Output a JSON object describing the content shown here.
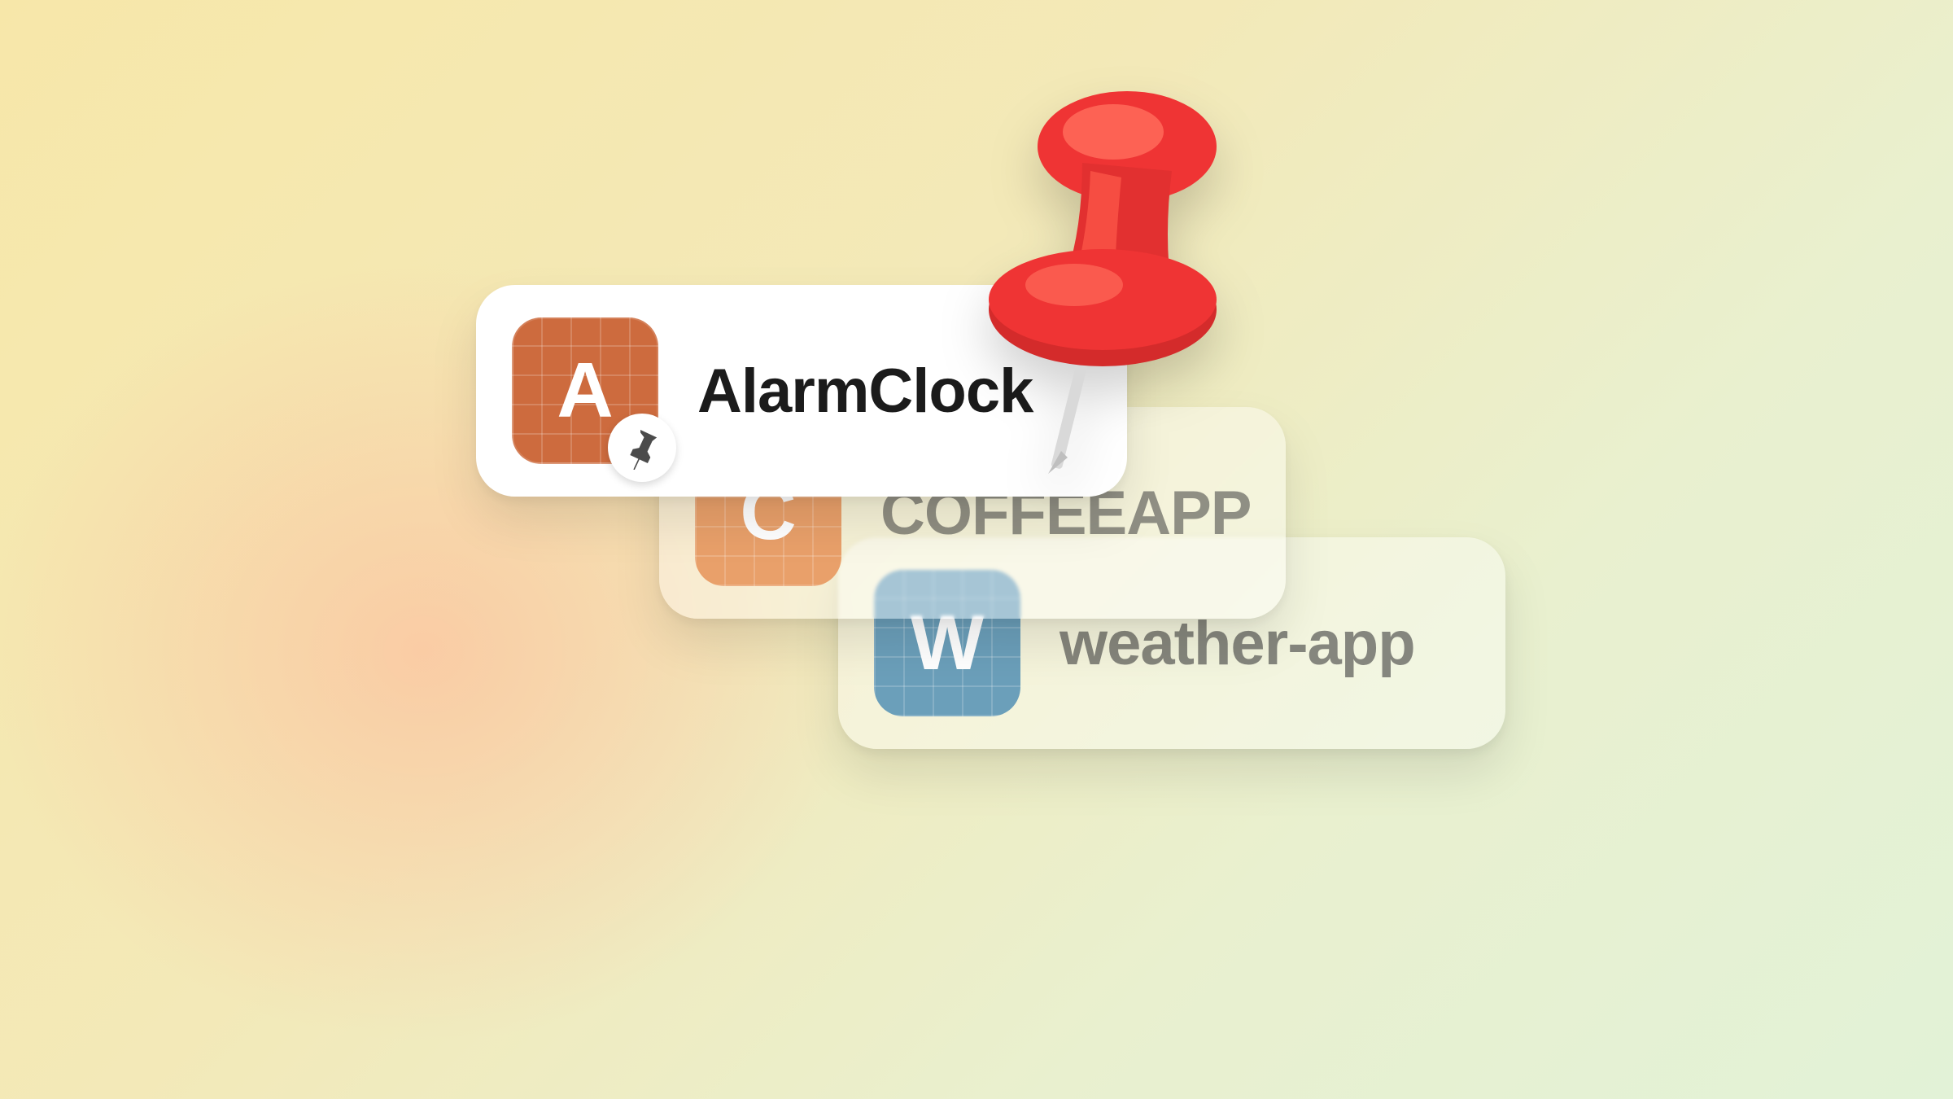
{
  "cards": [
    {
      "letter": "A",
      "label": "AlarmClock",
      "pinned": true,
      "icon_color": "#cd6b3e"
    },
    {
      "letter": "C",
      "label": "COFFEEAPP",
      "pinned": false,
      "icon_color": "#e9a06a"
    },
    {
      "letter": "W",
      "label": "weather-app",
      "pinned": false,
      "icon_color": "#6b9fba"
    }
  ],
  "decorations": {
    "big_pin_color": "#ef3434",
    "pin_badge_color": "#4b4b4b"
  }
}
